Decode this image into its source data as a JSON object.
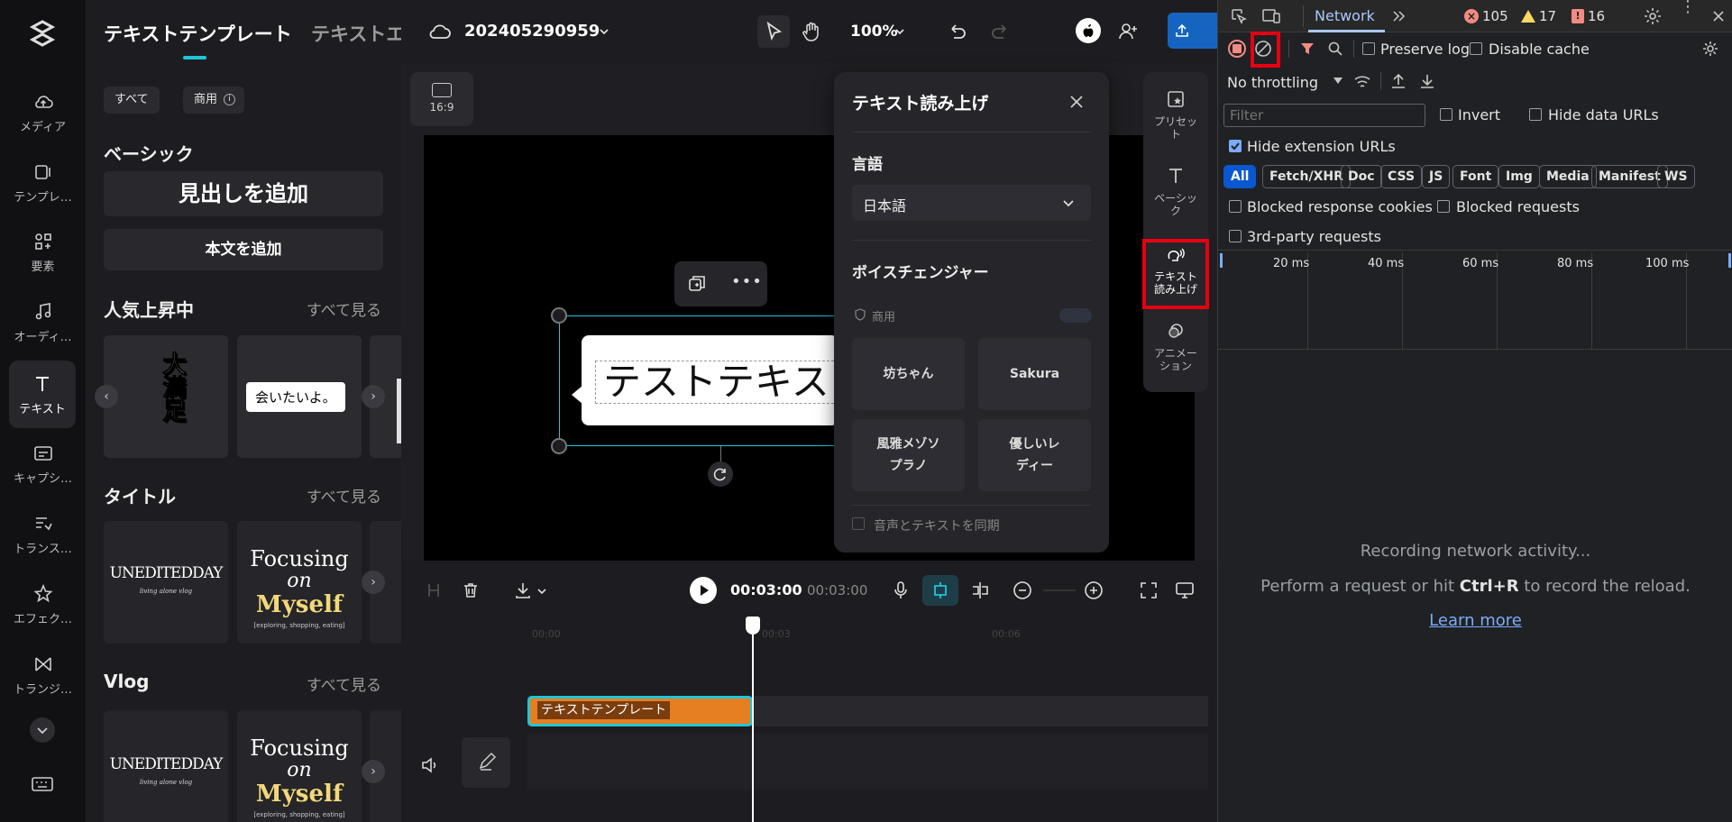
{
  "rail": {
    "items": [
      {
        "label": "メディア",
        "icon": "cloud-upload-icon"
      },
      {
        "label": "テンプレ…",
        "icon": "template-icon"
      },
      {
        "label": "要素",
        "icon": "elements-icon"
      },
      {
        "label": "オーディ…",
        "icon": "music-note-icon"
      },
      {
        "label": "テキスト",
        "icon": "text-icon"
      },
      {
        "label": "キャプシ…",
        "icon": "captions-icon"
      },
      {
        "label": "トランス…",
        "icon": "transcript-icon"
      },
      {
        "label": "エフェク…",
        "icon": "effects-icon"
      },
      {
        "label": "トランジ…",
        "icon": "transition-icon"
      }
    ]
  },
  "panel": {
    "tabs": [
      "テキストテンプレート",
      "テキストエ"
    ],
    "chips": [
      "すべて",
      "商用"
    ],
    "basic": {
      "title": "ベーシック",
      "heading_btn": "見出しを追加",
      "body_btn": "本文を追加"
    },
    "trending": {
      "title": "人気上昇中",
      "see_all": "すべて見る",
      "card1_text": "大満足",
      "card2_text": "会いたいよ。"
    },
    "titles": {
      "title": "タイトル",
      "see_all": "すべて見る",
      "card1_main": "UNEDITEDDAY",
      "card1_sub": "living alone vlog",
      "card2_line1": "Focusing",
      "card2_line2": "on",
      "card2_line3": "Myself",
      "card2_sub": "[exploring, shopping, eating]"
    },
    "vlog": {
      "title": "Vlog",
      "see_all": "すべて見る",
      "card1_main": "UNEDITEDDAY",
      "card1_sub": "living alone vlog",
      "card2_line1": "Focusing",
      "card2_line2": "on",
      "card2_line3": "Myself",
      "card2_sub": "[exploring, shopping, eating]"
    }
  },
  "topbar": {
    "project_name": "202405290959",
    "zoom": "100%",
    "ratio": "16:9"
  },
  "canvas": {
    "text": "テストテキス"
  },
  "tts": {
    "title": "テキスト読み上げ",
    "language_label": "言語",
    "language_value": "日本語",
    "voice_changer_label": "ボイスチェンジャー",
    "commercial_label": "商用",
    "voices": [
      "坊ちゃん",
      "Sakura",
      "風雅メゾソ\nプラノ",
      "優しいレ\nディー"
    ],
    "sync_label": "音声とテキストを同期"
  },
  "tools": [
    {
      "label": "プリセッ\nト",
      "icon": "preset-icon"
    },
    {
      "label": "ベーシッ\nク",
      "icon": "text-basic-icon"
    },
    {
      "label": "テキスト\n読み上げ",
      "icon": "text-to-speech-icon"
    },
    {
      "label": "アニメー\nション",
      "icon": "animation-icon"
    }
  ],
  "timeline": {
    "current_time": "00:03:00",
    "total_time": "00:03:00",
    "clip_label": "テキストテンプレート",
    "ticks": [
      "00:00",
      "00:03",
      "00:06"
    ]
  },
  "devtools": {
    "tab": "Network",
    "errors": "105",
    "warnings": "17",
    "issues": "16",
    "preserve_log": "Preserve log",
    "disable_cache": "Disable cache",
    "throttling": "No throttling",
    "filter_placeholder": "Filter",
    "invert": "Invert",
    "hide_data_urls": "Hide data URLs",
    "hide_extension_urls": "Hide extension URLs",
    "types": [
      "All",
      "Fetch/XHR",
      "Doc",
      "CSS",
      "JS",
      "Font",
      "Img",
      "Media",
      "Manifest",
      "WS"
    ],
    "blocked_response_cookies": "Blocked response cookies",
    "blocked_requests": "Blocked requests",
    "third_party": "3rd-party requests",
    "ms_labels": [
      "20 ms",
      "40 ms",
      "60 ms",
      "80 ms",
      "100 ms"
    ],
    "recording": "Recording network activity...",
    "perform_prefix": "Perform a request or hit ",
    "perform_key": "Ctrl+R",
    "perform_suffix": " to record the reload.",
    "learn_more": "Learn more"
  },
  "colors": {
    "accent": "#22c5d6",
    "highlight": "#e60012",
    "clip": "#e67e22",
    "devtools_blue": "#7cacf8"
  }
}
